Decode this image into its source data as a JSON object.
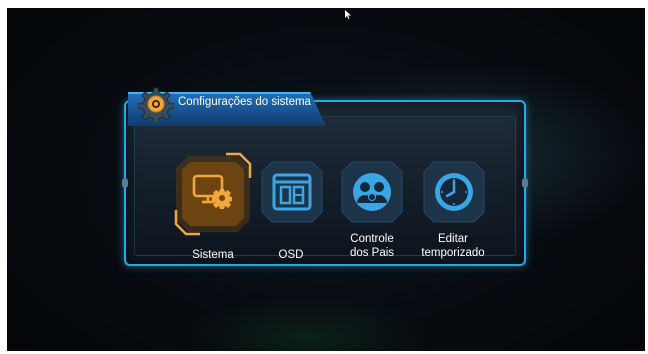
{
  "colors": {
    "accent": "#2aa9e0",
    "selected": "#f2a73b",
    "header": "#1f6fb8",
    "icon_blue": "#3aa6e6"
  },
  "header": {
    "title": "Configurações do sistema",
    "icon": "gear-icon"
  },
  "menu": {
    "selected_index": 0,
    "items": [
      {
        "label": "Sistema",
        "icon": "monitor-gear-icon"
      },
      {
        "label": "OSD",
        "icon": "osd-layout-icon"
      },
      {
        "label": "Controle\ndos Pais",
        "icon": "parental-users-icon"
      },
      {
        "label": "Editar\ntemporizado",
        "icon": "clock-icon"
      }
    ]
  }
}
